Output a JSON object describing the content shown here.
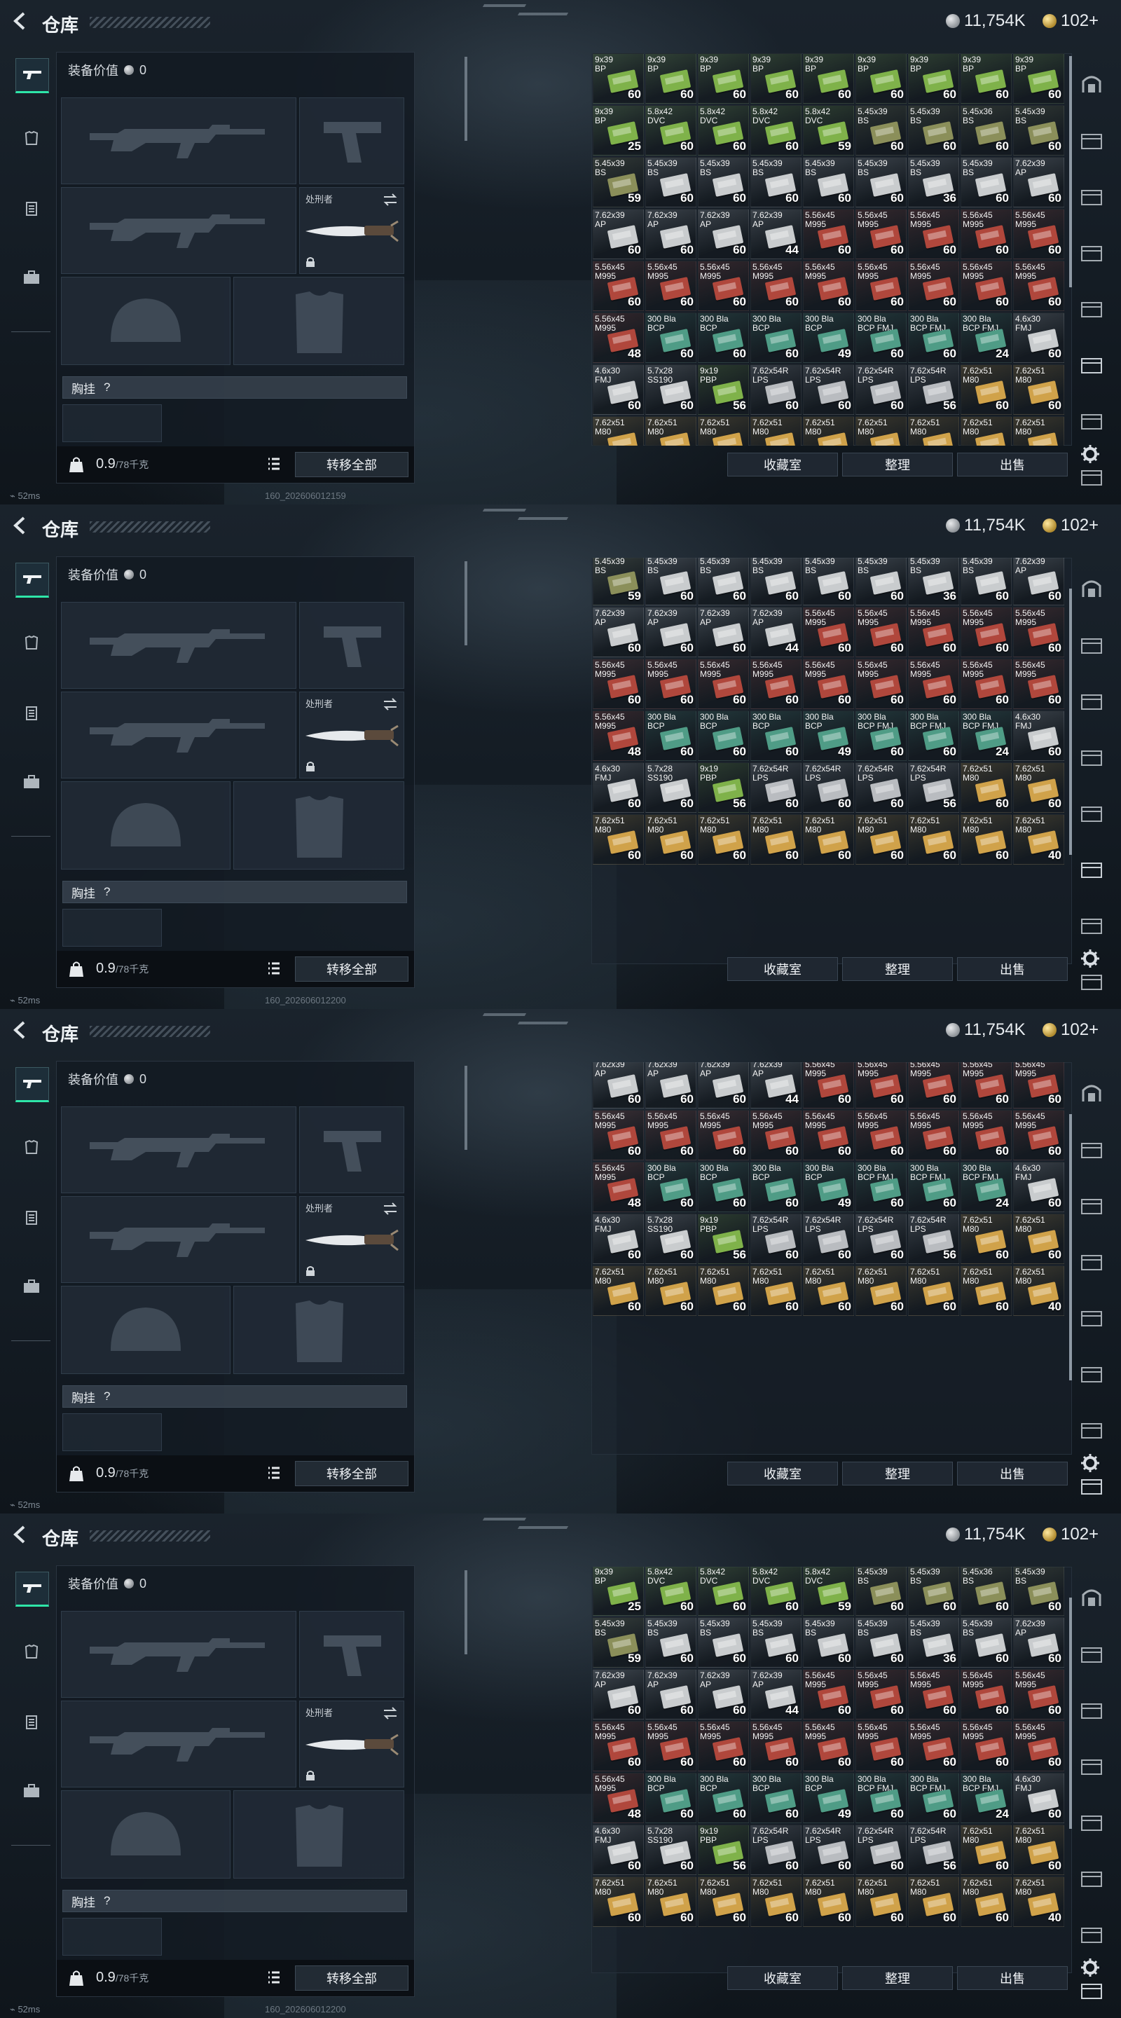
{
  "topbar": {
    "title": "仓库",
    "silver": "11,754K",
    "gold": "102+"
  },
  "equipment": {
    "value_label": "装备价值",
    "value": "0",
    "knife_name": "处刑者",
    "vest_label": "胸挂",
    "vest_help": "?",
    "weight_value": "0.9",
    "weight_cap": "/78千克",
    "transfer_all": "转移全部"
  },
  "actions": {
    "collection": "收藏室",
    "sort": "整理",
    "sell": "出售"
  },
  "status": {
    "ping": "52ms"
  },
  "frames": [
    {
      "stamp": "160_202606012159"
    },
    {
      "stamp": "160_202606012200"
    },
    {
      "stamp": ""
    },
    {
      "stamp": "160_202606012200"
    }
  ],
  "colors": {
    "accent": "#2ee6a8",
    "box_green": "#7fb24a",
    "box_olive": "#8b8f5a",
    "box_white": "#c9ccce",
    "box_red": "#b0473c",
    "box_teal": "#4f9c86",
    "box_tan": "#d0a24a",
    "box_grey": "#b9bcc0"
  },
  "ammo_rows": [
    [
      {
        "cal": "9x39",
        "type": "BP",
        "qty": "60",
        "c": "box_green"
      },
      {
        "cal": "9x39",
        "type": "BP",
        "qty": "60",
        "c": "box_green"
      },
      {
        "cal": "9x39",
        "type": "BP",
        "qty": "60",
        "c": "box_green"
      },
      {
        "cal": "9x39",
        "type": "BP",
        "qty": "60",
        "c": "box_green"
      },
      {
        "cal": "9x39",
        "type": "BP",
        "qty": "60",
        "c": "box_green"
      },
      {
        "cal": "9x39",
        "type": "BP",
        "qty": "60",
        "c": "box_green"
      },
      {
        "cal": "9x39",
        "type": "BP",
        "qty": "60",
        "c": "box_green"
      },
      {
        "cal": "9x39",
        "type": "BP",
        "qty": "60",
        "c": "box_green"
      },
      {
        "cal": "9x39",
        "type": "BP",
        "qty": "60",
        "c": "box_green"
      }
    ],
    [
      {
        "cal": "9x39",
        "type": "BP",
        "qty": "25",
        "c": "box_green"
      },
      {
        "cal": "5.8x42",
        "type": "DVC",
        "qty": "60",
        "c": "box_green"
      },
      {
        "cal": "5.8x42",
        "type": "DVC",
        "qty": "60",
        "c": "box_green"
      },
      {
        "cal": "5.8x42",
        "type": "DVC",
        "qty": "60",
        "c": "box_green"
      },
      {
        "cal": "5.8x42",
        "type": "DVC",
        "qty": "59",
        "c": "box_green"
      },
      {
        "cal": "5.45x39",
        "type": "BS",
        "qty": "60",
        "c": "box_olive"
      },
      {
        "cal": "5.45x39",
        "type": "BS",
        "qty": "60",
        "c": "box_olive"
      },
      {
        "cal": "5.45x36",
        "type": "BS",
        "qty": "60",
        "c": "box_olive"
      },
      {
        "cal": "5.45x39",
        "type": "BS",
        "qty": "60",
        "c": "box_olive"
      }
    ],
    [
      {
        "cal": "5.45x39",
        "type": "BS",
        "qty": "59",
        "c": "box_olive"
      },
      {
        "cal": "5.45x39",
        "type": "BS",
        "qty": "60",
        "c": "box_white"
      },
      {
        "cal": "5.45x39",
        "type": "BS",
        "qty": "60",
        "c": "box_white"
      },
      {
        "cal": "5.45x39",
        "type": "BS",
        "qty": "60",
        "c": "box_white"
      },
      {
        "cal": "5.45x39",
        "type": "BS",
        "qty": "60",
        "c": "box_white"
      },
      {
        "cal": "5.45x39",
        "type": "BS",
        "qty": "60",
        "c": "box_white"
      },
      {
        "cal": "5.45x39",
        "type": "BS",
        "qty": "36",
        "c": "box_white"
      },
      {
        "cal": "5.45x39",
        "type": "BS",
        "qty": "60",
        "c": "box_white"
      },
      {
        "cal": "7.62x39",
        "type": "AP",
        "qty": "60",
        "c": "box_white"
      }
    ],
    [
      {
        "cal": "7.62x39",
        "type": "AP",
        "qty": "60",
        "c": "box_white"
      },
      {
        "cal": "7.62x39",
        "type": "AP",
        "qty": "60",
        "c": "box_white"
      },
      {
        "cal": "7.62x39",
        "type": "AP",
        "qty": "60",
        "c": "box_white"
      },
      {
        "cal": "7.62x39",
        "type": "AP",
        "qty": "44",
        "c": "box_white"
      },
      {
        "cal": "5.56x45",
        "type": "M995",
        "qty": "60",
        "c": "box_red"
      },
      {
        "cal": "5.56x45",
        "type": "M995",
        "qty": "60",
        "c": "box_red"
      },
      {
        "cal": "5.56x45",
        "type": "M995",
        "qty": "60",
        "c": "box_red"
      },
      {
        "cal": "5.56x45",
        "type": "M995",
        "qty": "60",
        "c": "box_red"
      },
      {
        "cal": "5.56x45",
        "type": "M995",
        "qty": "60",
        "c": "box_red"
      }
    ],
    [
      {
        "cal": "5.56x45",
        "type": "M995",
        "qty": "60",
        "c": "box_red"
      },
      {
        "cal": "5.56x45",
        "type": "M995",
        "qty": "60",
        "c": "box_red"
      },
      {
        "cal": "5.56x45",
        "type": "M995",
        "qty": "60",
        "c": "box_red"
      },
      {
        "cal": "5.56x45",
        "type": "M995",
        "qty": "60",
        "c": "box_red"
      },
      {
        "cal": "5.56x45",
        "type": "M995",
        "qty": "60",
        "c": "box_red"
      },
      {
        "cal": "5.56x45",
        "type": "M995",
        "qty": "60",
        "c": "box_red"
      },
      {
        "cal": "5.56x45",
        "type": "M995",
        "qty": "60",
        "c": "box_red"
      },
      {
        "cal": "5.56x45",
        "type": "M995",
        "qty": "60",
        "c": "box_red"
      },
      {
        "cal": "5.56x45",
        "type": "M995",
        "qty": "60",
        "c": "box_red"
      }
    ],
    [
      {
        "cal": "5.56x45",
        "type": "M995",
        "qty": "48",
        "c": "box_red"
      },
      {
        "cal": "300 Bla",
        "type": "BCP",
        "qty": "60",
        "c": "box_teal"
      },
      {
        "cal": "300 Bla",
        "type": "BCP",
        "qty": "60",
        "c": "box_teal"
      },
      {
        "cal": "300 Bla",
        "type": "BCP",
        "qty": "60",
        "c": "box_teal"
      },
      {
        "cal": "300 Bla",
        "type": "BCP",
        "qty": "49",
        "c": "box_teal"
      },
      {
        "cal": "300 Bla",
        "type": "BCP FMJ",
        "qty": "60",
        "c": "box_teal"
      },
      {
        "cal": "300 Bla",
        "type": "BCP FMJ",
        "qty": "60",
        "c": "box_teal"
      },
      {
        "cal": "300 Bla",
        "type": "BCP FMJ",
        "qty": "24",
        "c": "box_teal"
      },
      {
        "cal": "4.6x30",
        "type": "FMJ",
        "qty": "60",
        "c": "box_white"
      }
    ],
    [
      {
        "cal": "4.6x30",
        "type": "FMJ",
        "qty": "60",
        "c": "box_white"
      },
      {
        "cal": "5.7x28",
        "type": "SS190",
        "qty": "60",
        "c": "box_white"
      },
      {
        "cal": "9x19",
        "type": "PBP",
        "qty": "56",
        "c": "box_green"
      },
      {
        "cal": "7.62x54R",
        "type": "LPS",
        "qty": "60",
        "c": "box_grey"
      },
      {
        "cal": "7.62x54R",
        "type": "LPS",
        "qty": "60",
        "c": "box_grey"
      },
      {
        "cal": "7.62x54R",
        "type": "LPS",
        "qty": "60",
        "c": "box_grey"
      },
      {
        "cal": "7.62x54R",
        "type": "LPS",
        "qty": "56",
        "c": "box_grey"
      },
      {
        "cal": "7.62x51",
        "type": "M80",
        "qty": "60",
        "c": "box_tan"
      },
      {
        "cal": "7.62x51",
        "type": "M80",
        "qty": "60",
        "c": "box_tan"
      }
    ],
    [
      {
        "cal": "7.62x51",
        "type": "M80",
        "qty": "60",
        "c": "box_tan"
      },
      {
        "cal": "7.62x51",
        "type": "M80",
        "qty": "60",
        "c": "box_tan"
      },
      {
        "cal": "7.62x51",
        "type": "M80",
        "qty": "60",
        "c": "box_tan"
      },
      {
        "cal": "7.62x51",
        "type": "M80",
        "qty": "60",
        "c": "box_tan"
      },
      {
        "cal": "7.62x51",
        "type": "M80",
        "qty": "60",
        "c": "box_tan"
      },
      {
        "cal": "7.62x51",
        "type": "M80",
        "qty": "60",
        "c": "box_tan"
      },
      {
        "cal": "7.62x51",
        "type": "M80",
        "qty": "60",
        "c": "box_tan"
      },
      {
        "cal": "7.62x51",
        "type": "M80",
        "qty": "60",
        "c": "box_tan"
      },
      {
        "cal": "7.62x51",
        "type": "M80",
        "qty": "40",
        "c": "box_tan"
      }
    ]
  ]
}
